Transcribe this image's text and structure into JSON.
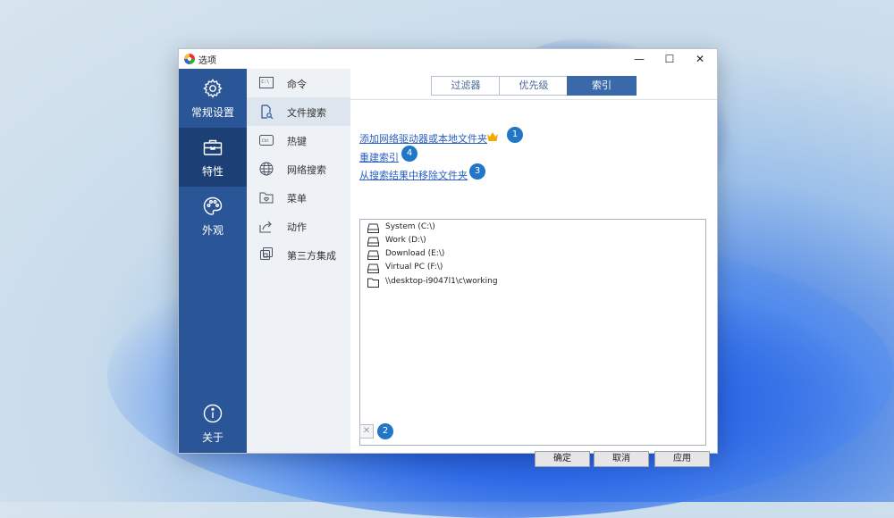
{
  "window": {
    "title": "选项"
  },
  "titlebar": {
    "minimize_glyph": "—",
    "maximize_glyph": "☐",
    "close_glyph": "✕"
  },
  "categories": [
    {
      "label": "常规设置",
      "icon": "gear-icon",
      "active": false
    },
    {
      "label": "特性",
      "icon": "toolbox-icon",
      "active": true
    },
    {
      "label": "外观",
      "icon": "palette-icon",
      "active": false
    },
    {
      "label": "关于",
      "icon": "info-icon",
      "active": false
    }
  ],
  "subnav": [
    {
      "label": "命令",
      "icon": "command-prompt-icon",
      "active": false
    },
    {
      "label": "文件搜索",
      "icon": "file-search-icon",
      "active": true
    },
    {
      "label": "热键",
      "icon": "ctrl-key-icon",
      "active": false
    },
    {
      "label": "网络搜索",
      "icon": "globe-icon",
      "active": false
    },
    {
      "label": "菜单",
      "icon": "menu-folder-icon",
      "active": false
    },
    {
      "label": "动作",
      "icon": "share-arrow-icon",
      "active": false
    },
    {
      "label": "第三方集成",
      "icon": "integration-icon",
      "active": false
    }
  ],
  "tabs": [
    {
      "label": "过滤器",
      "active": false
    },
    {
      "label": "优先级",
      "active": false
    },
    {
      "label": "索引",
      "active": true
    }
  ],
  "links": {
    "add_drive": "添加网络驱动器或本地文件夹",
    "rebuild_index": "重建索引",
    "remove_folder": "从搜索结果中移除文件夹"
  },
  "badges": {
    "one": "1",
    "two": "2",
    "three": "3",
    "four": "4"
  },
  "index_items": [
    {
      "label": "System (C:\\)",
      "icon": "drive-icon"
    },
    {
      "label": "Work (D:\\)",
      "icon": "drive-icon"
    },
    {
      "label": "Download (E:\\)",
      "icon": "drive-icon"
    },
    {
      "label": "Virtual PC (F:\\)",
      "icon": "drive-icon"
    },
    {
      "label": "\\\\desktop-i9047l1\\c\\working",
      "icon": "folder-icon"
    }
  ],
  "remove_button": {
    "glyph": "✕"
  },
  "buttons": {
    "ok": "确定",
    "cancel": "取消",
    "apply": "应用"
  },
  "colors": {
    "sidebar": "#2a5597",
    "sidebar_active": "#1c3f75",
    "tab_active": "#3a69aa",
    "link": "#2b5fc0",
    "badge": "#2176c7",
    "crown": "#f2a900"
  }
}
